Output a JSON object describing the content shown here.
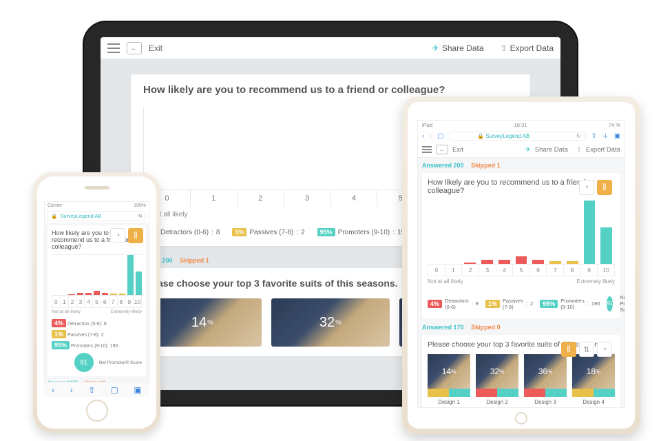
{
  "colors": {
    "teal": "#55d0c4",
    "red": "#ec5a5a",
    "yellow": "#e8c14b",
    "amber": "#efb04a"
  },
  "app": {
    "brand": "SurveyLegend AB",
    "exit_label": "Exit",
    "share_label": "Share Data",
    "export_label": "Export Data",
    "answered_label": "Answered",
    "skipped_label": "Skipped"
  },
  "toolchip": {
    "gauge": "◔",
    "bars": "⫼",
    "flow": "⇅"
  },
  "nps": {
    "question": "How likely are you to recommend us to a friend or colleague?",
    "low_label": "Not at all likely",
    "high_label": "Extremely likely",
    "numbers": [
      "0",
      "1",
      "2",
      "3",
      "4",
      "5",
      "6",
      "7",
      "8",
      "9",
      "10"
    ],
    "answered": 200,
    "skipped": 1,
    "legend": {
      "detractors": {
        "pct": "4%",
        "label": "Detractors (0-6)",
        "count": "8"
      },
      "passives": {
        "pct": "1%",
        "label": "Passives (7-8)",
        "count": "2"
      },
      "promoters": {
        "pct": "95%",
        "label": "Promoters (9-10)",
        "count": "190"
      },
      "score_label": "Net Promoter® Score",
      "score": "91"
    }
  },
  "suits": {
    "question": "Please choose your top 3 favorite suits of this seasons.",
    "answered": 170,
    "skipped": 0,
    "items": [
      {
        "pct": "14",
        "label": "Design 1"
      },
      {
        "pct": "32",
        "label": "Design 2"
      },
      {
        "pct": "36",
        "label": "Design 3"
      },
      {
        "pct": "18",
        "label": "Design 4"
      }
    ]
  },
  "tablet": {
    "time": "18:31",
    "battery": "74 %",
    "device": "iPad"
  },
  "phone": {
    "carrier": "Carrier",
    "battery": "100%"
  },
  "chart_data": {
    "type": "bar",
    "title": "How likely are you to recommend us to a friend or colleague?",
    "xlabel": "",
    "ylabel": "",
    "categories": [
      "0",
      "1",
      "2",
      "3",
      "4",
      "5",
      "6",
      "7",
      "8",
      "9",
      "10"
    ],
    "series": [
      {
        "name": "Detractors",
        "color": "#ec5a5a",
        "values": [
          0,
          0,
          2,
          8,
          8,
          14,
          8,
          0,
          0,
          0,
          0
        ]
      },
      {
        "name": "Passives",
        "color": "#e8c14b",
        "values": [
          0,
          0,
          0,
          0,
          0,
          0,
          0,
          4,
          4,
          0,
          0
        ]
      },
      {
        "name": "Promoters",
        "color": "#55d0c4",
        "values": [
          0,
          0,
          0,
          0,
          0,
          0,
          0,
          0,
          0,
          100,
          58
        ]
      }
    ],
    "ylim": [
      0,
      100
    ],
    "x_axis_endpoints": [
      "Not at all likely",
      "Extremely likely"
    ],
    "nps_score": 91,
    "summary": {
      "detractors_pct": 4,
      "passives_pct": 1,
      "promoters_pct": 95,
      "n": 200
    }
  }
}
